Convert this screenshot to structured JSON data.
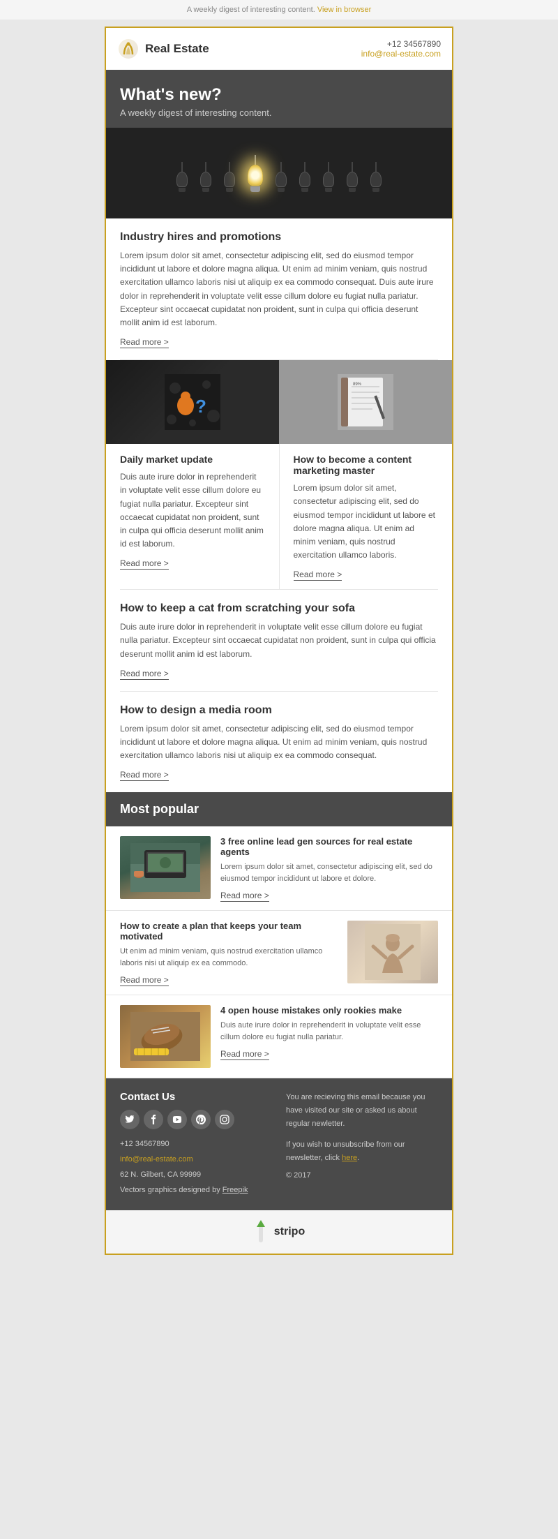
{
  "topbar": {
    "text": "A weekly digest of interesting content.",
    "link_text": "View in browser"
  },
  "header": {
    "logo_text": "Real Estate",
    "phone": "+12 34567890",
    "email": "info@real-estate.com"
  },
  "hero": {
    "title": "What's new?",
    "subtitle": "A weekly digest of interesting content."
  },
  "article1": {
    "title": "Industry hires and promotions",
    "text": "Lorem ipsum dolor sit amet, consectetur adipiscing elit, sed do eiusmod tempor incididunt ut labore et dolore magna aliqua. Ut enim ad minim veniam, quis nostrud exercitation ullamco laboris nisi ut aliquip ex ea commodo consequat. Duis aute irure dolor in reprehenderit in voluptate velit esse cillum dolore eu fugiat nulla pariatur. Excepteur sint occaecat cupidatat non proident, sunt in culpa qui officia deserunt mollit anim id est laborum.",
    "read_more": "Read more >"
  },
  "article2": {
    "title": "Daily market update",
    "text": "Duis aute irure dolor in reprehenderit in voluptate velit esse cillum dolore eu fugiat nulla pariatur. Excepteur sint occaecat cupidatat non proident, sunt in culpa qui officia deserunt mollit anim id est laborum.",
    "read_more": "Read more >"
  },
  "article3": {
    "title": "How to become a content marketing master",
    "text": "Lorem ipsum dolor sit amet, consectetur adipiscing elit, sed do eiusmod tempor incididunt ut labore et dolore magna aliqua. Ut enim ad minim veniam, quis nostrud exercitation ullamco laboris.",
    "read_more": "Read more >"
  },
  "article4": {
    "title": "How to keep a cat from scratching your sofa",
    "text": "Duis aute irure dolor in reprehenderit in voluptate velit esse cillum dolore eu fugiat nulla pariatur. Excepteur sint occaecat cupidatat non proident, sunt in culpa qui officia deserunt mollit anim id est laborum.",
    "read_more": "Read more >"
  },
  "article5": {
    "title": "How to design a media room",
    "text": "Lorem ipsum dolor sit amet, consectetur adipiscing elit, sed do eiusmod tempor incididunt ut labore et dolore magna aliqua. Ut enim ad minim veniam, quis nostrud exercitation ullamco laboris nisi ut aliquip ex ea commodo consequat.",
    "read_more": "Read more >"
  },
  "most_popular": {
    "section_title": "Most popular",
    "item1": {
      "title": "3 free online lead gen sources for real estate agents",
      "text": "Lorem ipsum dolor sit amet, consectetur adipiscing elit, sed do eiusmod tempor incididunt ut labore et dolore.",
      "read_more": "Read more >"
    },
    "item2": {
      "title": "How to create a plan that keeps your team motivated",
      "text": "Ut enim ad minim veniam, quis nostrud exercitation ullamco laboris nisi ut aliquip ex ea commodo.",
      "read_more": "Read more >"
    },
    "item3": {
      "title": "4 open house mistakes only rookies make",
      "text": "Duis aute irure dolor in reprehenderit in voluptate velit esse cillum dolore eu fugiat nulla pariatur.",
      "read_more": "Read more >"
    }
  },
  "footer": {
    "contact_title": "Contact Us",
    "phone": "+12 34567890",
    "email": "info@real-estate.com",
    "address1": "62 N. Gilbert, CA 99999",
    "credits": "Vectors graphics designed by",
    "credits_link": "Freepik",
    "right_text1": "You are recieving this email because you have visited our site or asked us about regular newletter.",
    "right_text2": "If you wish to unsubscribe from our newsletter, click",
    "unsubscribe_link": "here",
    "copyright": "© 2017"
  },
  "stripo": {
    "label": "stripo"
  },
  "colors": {
    "gold": "#c8a020",
    "dark_bg": "#4a4a4a",
    "text_dark": "#333333",
    "text_light": "#555555"
  }
}
